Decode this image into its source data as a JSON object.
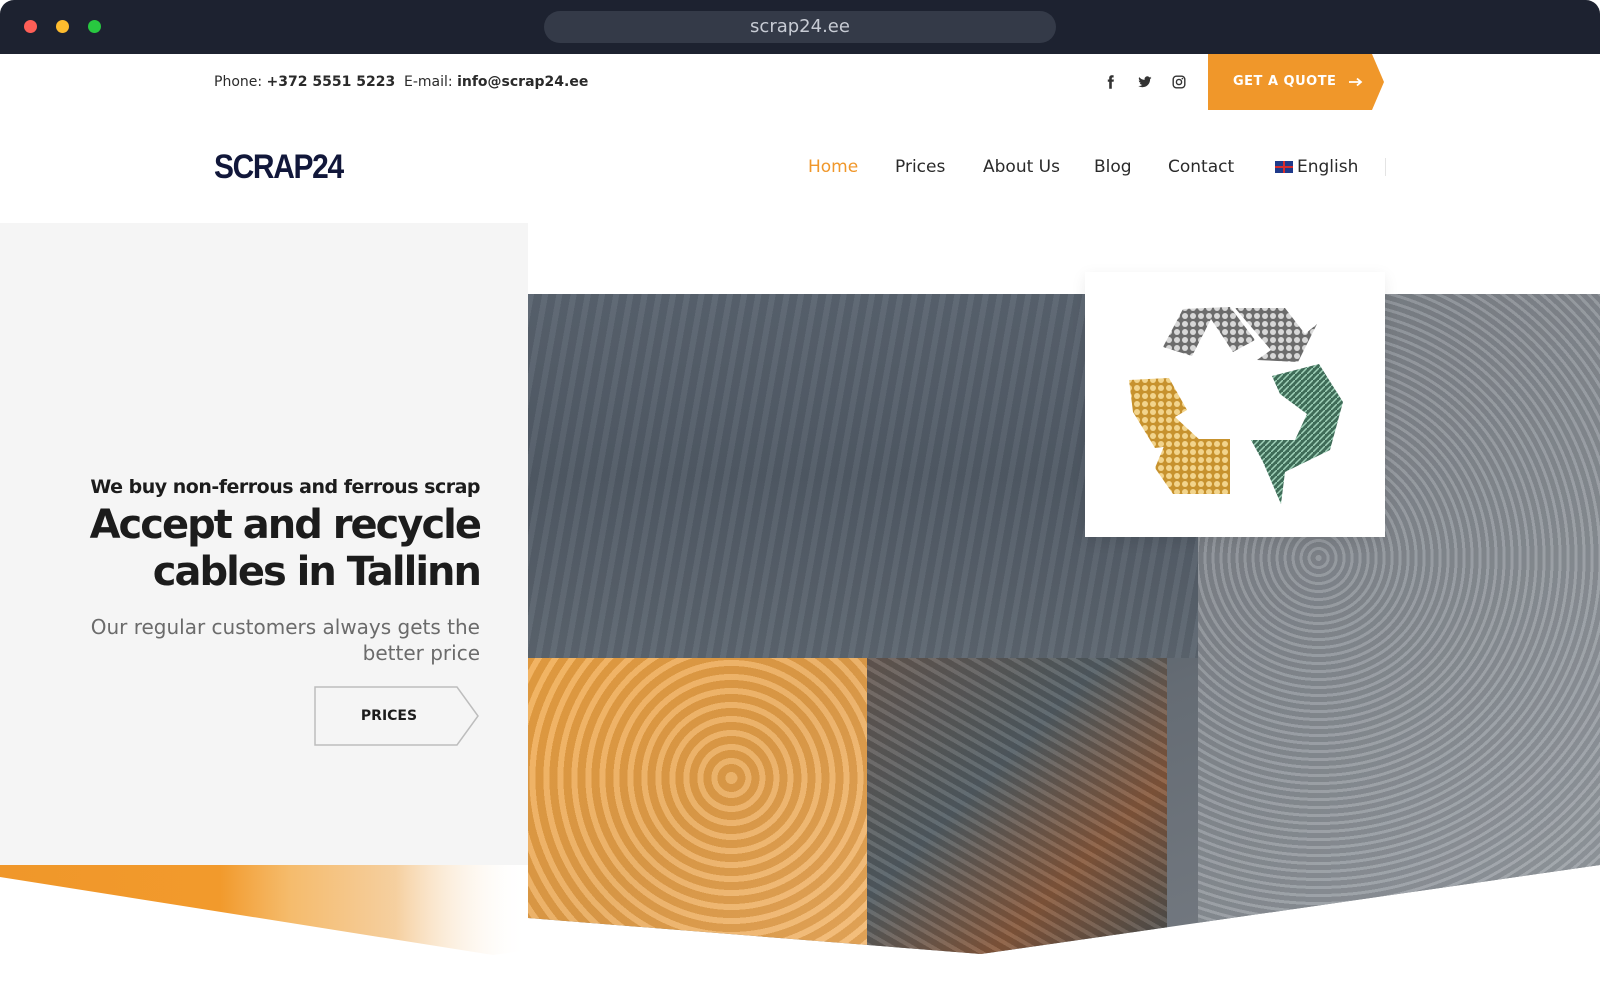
{
  "browser": {
    "url": "scrap24.ee"
  },
  "topbar": {
    "phone_label": "Phone:",
    "phone_value": "+372 5551 5223",
    "email_label": "E-mail:",
    "email_value": "info@scrap24.ee",
    "quote_label": "GET A QUOTE",
    "social": [
      "facebook-icon",
      "twitter-icon",
      "instagram-icon"
    ]
  },
  "header": {
    "logo": "SCRAP24",
    "nav": [
      "Home",
      "Prices",
      "About Us",
      "Blog",
      "Contact"
    ],
    "active_nav": "Home",
    "language": "English"
  },
  "hero": {
    "subtitle": "We buy non-ferrous and ferrous scrap",
    "title_line1": "Accept and recycle",
    "title_line2": "cables in Tallinn",
    "description": "Our regular customers always gets the better price",
    "button": "PRICES"
  },
  "colors": {
    "accent": "#f0972a",
    "dark": "#1c1c1c",
    "logo": "#11173a",
    "chrome": "#1d2230"
  }
}
